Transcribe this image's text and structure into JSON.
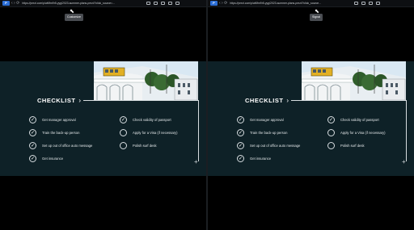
{
  "browser": {
    "logo_text": "P",
    "nav_glyph": "‹ › ⟳",
    "left_url": "https://prezi.com/p/wl6fm9r5-yyg/2023-summer-plans-prezi/?click_source=...",
    "right_url": "https://prezi.com/p/wl6fm9r5-yyg/2023-summer-plans-prezi/?click_source..."
  },
  "left_tooltip": "Customize",
  "right_tooltip": "Signal",
  "slide": {
    "title": "CHECKLIST",
    "title_chevron": "›",
    "corner_plus": "+",
    "left_column": [
      {
        "label": "Get manager approval",
        "checked": true
      },
      {
        "label": "Train the back-up person",
        "checked": true
      },
      {
        "label": "Set up out of office auto message",
        "checked": true
      },
      {
        "label": "Get insurance",
        "checked": true
      }
    ],
    "right_column": [
      {
        "label": "Check validity of passport",
        "checked": true
      },
      {
        "label": "Apply for a Visa (if necessary)",
        "checked": false
      },
      {
        "label": "Polish surf desk",
        "checked": false
      }
    ],
    "check_glyph": "✓"
  },
  "colors": {
    "slide_bg": "#0e2127",
    "accent_line": "#d7dde0"
  }
}
